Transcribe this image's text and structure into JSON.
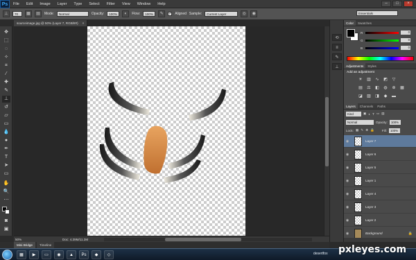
{
  "app": {
    "logo": "Ps"
  },
  "menu": [
    "File",
    "Edit",
    "Image",
    "Layer",
    "Type",
    "Select",
    "Filter",
    "View",
    "Window",
    "Help"
  ],
  "options_bar": {
    "brush_size": "70",
    "mode_label": "Mode:",
    "mode_value": "Normal",
    "opacity_label": "Opacity:",
    "opacity_value": "100%",
    "flow_label": "Flow:",
    "flow_value": "100%",
    "aligned_label": "Aligned",
    "sample_label": "Sample:",
    "sample_value": "Current Layer",
    "workspace": "Essentials"
  },
  "document": {
    "tab_title": "sourceimage.jpg @ 50% (Layer 7, RGB/8#)",
    "close_glyph": "×"
  },
  "status": {
    "zoom": "50%",
    "doc_size": "Doc: 4.39M/11.3M"
  },
  "bridge_tabs": [
    "Mini Bridge",
    "Timeline"
  ],
  "color_panel": {
    "tabs": [
      "Color",
      "Swatches"
    ],
    "channels": [
      {
        "label": "R",
        "value": "0",
        "gradient": "linear-gradient(90deg,#000,#f00)"
      },
      {
        "label": "G",
        "value": "0",
        "gradient": "linear-gradient(90deg,#000,#0f0)"
      },
      {
        "label": "B",
        "value": "0",
        "gradient": "linear-gradient(90deg,#000,#00f)"
      }
    ]
  },
  "adjustments_panel": {
    "tabs": [
      "Adjustments",
      "Styles"
    ],
    "title": "Add an adjustment"
  },
  "layers_panel": {
    "tabs": [
      "Layers",
      "Channels",
      "Paths"
    ],
    "filter_kind": "Kind",
    "blend_mode": "Normal",
    "opacity_label": "Opacity:",
    "opacity_value": "100%",
    "lock_label": "Lock:",
    "fill_label": "Fill:",
    "fill_value": "100%",
    "layers": [
      {
        "name": "Layer 7",
        "selected": true
      },
      {
        "name": "Layer 6",
        "selected": false
      },
      {
        "name": "Layer 5",
        "selected": false
      },
      {
        "name": "Layer 1",
        "selected": false
      },
      {
        "name": "Layer 4",
        "selected": false
      },
      {
        "name": "Layer 3",
        "selected": false
      },
      {
        "name": "Layer 2",
        "selected": false
      },
      {
        "name": "Background",
        "selected": false,
        "background": true
      }
    ]
  },
  "taskbar": {
    "tray": "desertfox"
  },
  "watermark": "pxleyes.com",
  "colors": {
    "accent_selected_layer": "#5e7a9c",
    "ps_logo": "#3fa9f5"
  }
}
